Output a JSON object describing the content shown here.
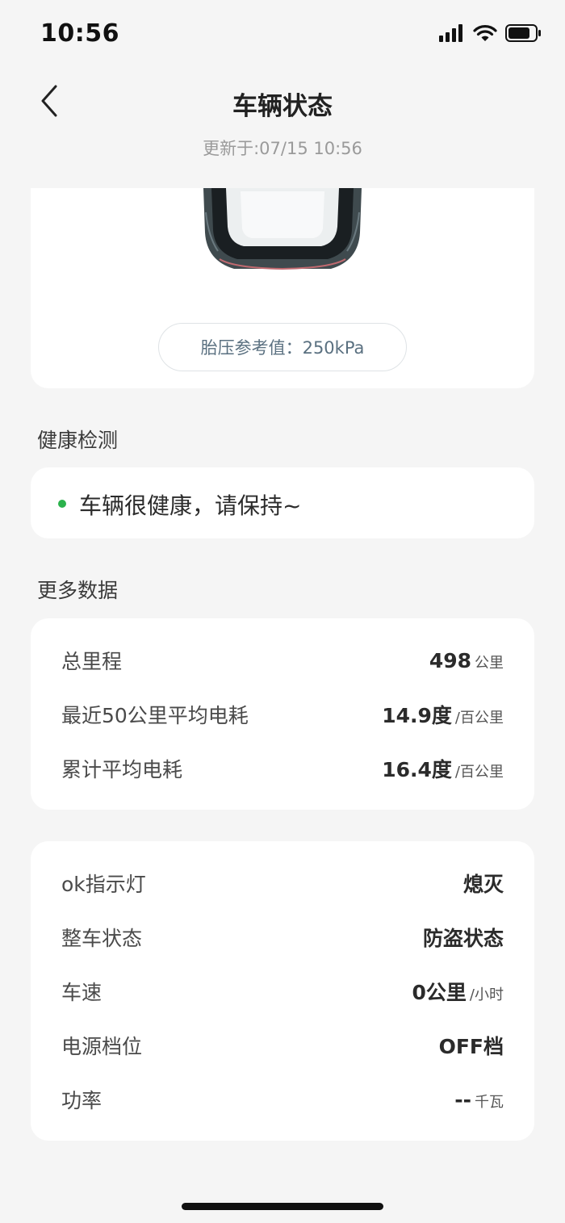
{
  "status_bar": {
    "time": "10:56"
  },
  "header": {
    "title": "车辆状态",
    "updated": "更新于:07/15 10:56"
  },
  "car_card": {
    "tire_pressure": "胎压参考值：250kPa"
  },
  "health": {
    "section_title": "健康检测",
    "status_text": "车辆很健康，请保持~",
    "status_color": "#2bb24c"
  },
  "more_data": {
    "section_title": "更多数据",
    "rows": [
      {
        "label": "总里程",
        "value": "498",
        "unit": "公里"
      },
      {
        "label": "最近50公里平均电耗",
        "value": "14.9度",
        "unit": "/百公里"
      },
      {
        "label": "累计平均电耗",
        "value": "16.4度",
        "unit": "/百公里"
      }
    ]
  },
  "status_data": {
    "rows": [
      {
        "label": "ok指示灯",
        "value": "熄灭",
        "unit": ""
      },
      {
        "label": "整车状态",
        "value": "防盗状态",
        "unit": ""
      },
      {
        "label": "车速",
        "value": "0公里",
        "unit": "/小时"
      },
      {
        "label": "电源档位",
        "value": "OFF档",
        "unit": ""
      },
      {
        "label": "功率",
        "value": "--",
        "unit": "千瓦"
      }
    ]
  }
}
